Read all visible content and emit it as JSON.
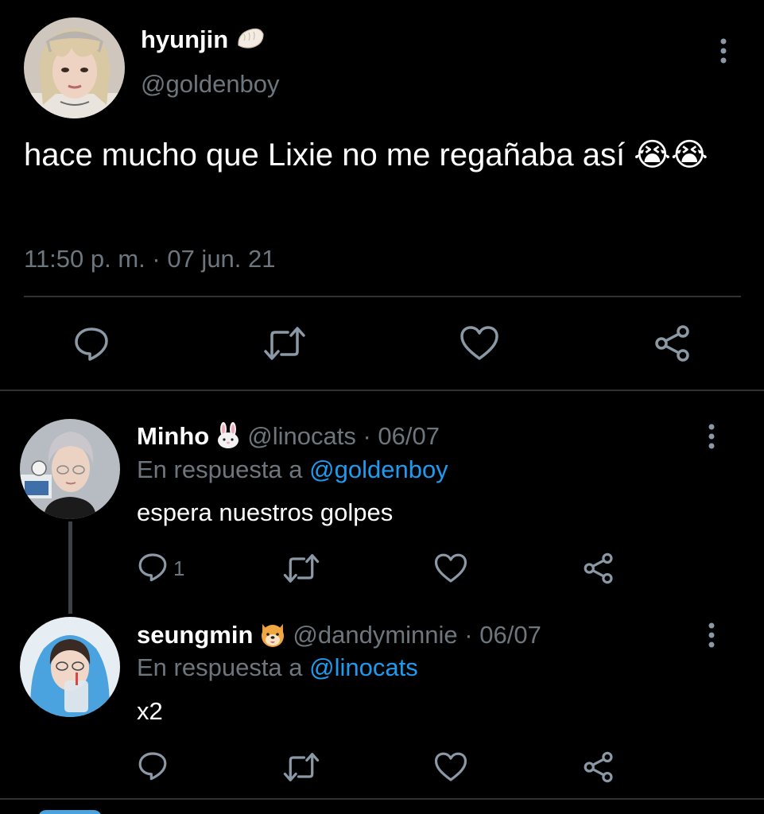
{
  "main_tweet": {
    "display_name": "hyunjin",
    "name_emoji": "dumpling",
    "handle": "@goldenboy",
    "text": "hace mucho que Lixie no me regañaba así 😭😭",
    "timestamp": "11:50 p. m. · 07 jun. 21",
    "actions": [
      "reply-icon",
      "retweet-icon",
      "like-icon",
      "share-icon"
    ]
  },
  "replies": [
    {
      "display_name": "Minho",
      "name_emoji": "🐰",
      "handle": "@linocats",
      "date": "· 06/07",
      "reply_prefix": "En respuesta a ",
      "reply_to": "@goldenboy",
      "text": "espera nuestros golpes",
      "reply_count": "1"
    },
    {
      "display_name": "seungmin",
      "name_emoji": "🐶",
      "handle": "@dandyminnie",
      "date": "· 06/07",
      "reply_prefix": "En respuesta a ",
      "reply_to": "@linocats",
      "text": "x2",
      "reply_count": ""
    }
  ],
  "colors": {
    "background": "#000000",
    "text": "#ffffff",
    "secondary_text": "#6e767d",
    "link": "#1d9bf0",
    "divider": "#2f3336",
    "icon": "#8b98a5"
  }
}
